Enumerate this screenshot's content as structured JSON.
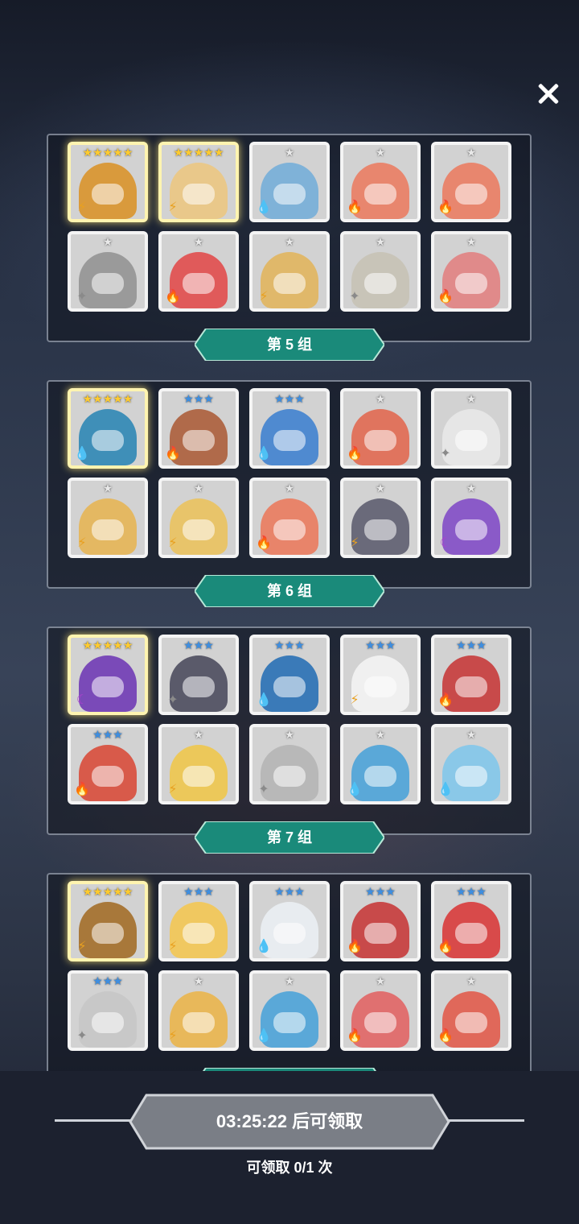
{
  "groups": [
    {
      "label": "",
      "cards": [
        {
          "name": "tiger-hero",
          "stars": "★★★★★",
          "stars_level": 5,
          "element": "earth",
          "elem_glyph": "⚡",
          "art": "#d99a3c",
          "gold": true
        },
        {
          "name": "elder-sage",
          "stars": "★★★★★",
          "stars_level": 5,
          "element": "earth",
          "elem_glyph": "⚡",
          "art": "#e9c88a",
          "gold": true
        },
        {
          "name": "mummy",
          "stars": "★",
          "stars_level": 1,
          "element": "water",
          "elem_glyph": "💧",
          "art": "#7fb2d8",
          "gold": false
        },
        {
          "name": "red-bow-girl",
          "stars": "★",
          "stars_level": 1,
          "element": "fire",
          "elem_glyph": "🔥",
          "art": "#e8866e",
          "gold": false
        },
        {
          "name": "red-bow-girl-2",
          "stars": "★",
          "stars_level": 1,
          "element": "fire",
          "elem_glyph": "🔥",
          "art": "#e8866e",
          "gold": false
        },
        {
          "name": "spiky-beast",
          "stars": "★",
          "stars_level": 1,
          "element": "light",
          "elem_glyph": "✦",
          "art": "#9a9a9a",
          "gold": false
        },
        {
          "name": "red-bird",
          "stars": "★",
          "stars_level": 1,
          "element": "fire",
          "elem_glyph": "🔥",
          "art": "#e05a5a",
          "gold": false
        },
        {
          "name": "golden-warrior",
          "stars": "★",
          "stars_level": 1,
          "element": "earth",
          "elem_glyph": "⚡",
          "art": "#e0b86a",
          "gold": false
        },
        {
          "name": "stone-helmet",
          "stars": "★",
          "stars_level": 1,
          "element": "light",
          "elem_glyph": "✦",
          "art": "#c8c4b8",
          "gold": false
        },
        {
          "name": "pink-moai",
          "stars": "★",
          "stars_level": 1,
          "element": "fire",
          "elem_glyph": "🔥",
          "art": "#e08a8a",
          "gold": false
        }
      ]
    },
    {
      "label": "第 5 组",
      "cards": [
        {
          "name": "blue-dragon",
          "stars": "★★★★★",
          "stars_level": 5,
          "element": "water",
          "elem_glyph": "💧",
          "art": "#3f8fb8",
          "gold": true
        },
        {
          "name": "antler-queen",
          "stars": "★★★",
          "stars_level": 3,
          "element": "fire",
          "elem_glyph": "🔥",
          "art": "#b06a4a",
          "gold": false
        },
        {
          "name": "crown-priestess",
          "stars": "★★★",
          "stars_level": 3,
          "element": "water",
          "elem_glyph": "💧",
          "art": "#4f8ad0",
          "gold": false
        },
        {
          "name": "cactus-red",
          "stars": "★",
          "stars_level": 1,
          "element": "fire",
          "elem_glyph": "🔥",
          "art": "#e0745e",
          "gold": false
        },
        {
          "name": "ghost",
          "stars": "★",
          "stars_level": 1,
          "element": "light",
          "elem_glyph": "✦",
          "art": "#e6e6e6",
          "gold": false
        },
        {
          "name": "lion",
          "stars": "★",
          "stars_level": 1,
          "element": "earth",
          "elem_glyph": "⚡",
          "art": "#e4b862",
          "gold": false
        },
        {
          "name": "golden-lion",
          "stars": "★",
          "stars_level": 1,
          "element": "earth",
          "elem_glyph": "⚡",
          "art": "#e8c46a",
          "gold": false
        },
        {
          "name": "red-helmet",
          "stars": "★",
          "stars_level": 1,
          "element": "fire",
          "elem_glyph": "🔥",
          "art": "#e8846a",
          "gold": false
        },
        {
          "name": "knight",
          "stars": "★",
          "stars_level": 1,
          "element": "earth",
          "elem_glyph": "⚡",
          "art": "#6a6a7a",
          "gold": false
        },
        {
          "name": "purple-mage",
          "stars": "★",
          "stars_level": 1,
          "element": "dark",
          "elem_glyph": "☾",
          "art": "#8a5ac8",
          "gold": false
        }
      ]
    },
    {
      "label": "第 6 组",
      "cards": [
        {
          "name": "hooded-purple",
          "stars": "★★★★★",
          "stars_level": 5,
          "element": "dark",
          "elem_glyph": "☾",
          "art": "#7a4ab8",
          "gold": true
        },
        {
          "name": "dark-swordsman",
          "stars": "★★★",
          "stars_level": 3,
          "element": "light",
          "elem_glyph": "✦",
          "art": "#5a5a6a",
          "gold": false
        },
        {
          "name": "blue-hood",
          "stars": "★★★",
          "stars_level": 3,
          "element": "water",
          "elem_glyph": "💧",
          "art": "#3a7ab8",
          "gold": false
        },
        {
          "name": "bunny",
          "stars": "★★★",
          "stars_level": 3,
          "element": "earth",
          "elem_glyph": "⚡",
          "art": "#f0f0f0",
          "gold": false
        },
        {
          "name": "oni-mask",
          "stars": "★★★",
          "stars_level": 3,
          "element": "fire",
          "elem_glyph": "🔥",
          "art": "#c84a4a",
          "gold": false
        },
        {
          "name": "red-hood",
          "stars": "★★★",
          "stars_level": 3,
          "element": "fire",
          "elem_glyph": "🔥",
          "art": "#d85a4a",
          "gold": false
        },
        {
          "name": "fluffy-yellow",
          "stars": "★",
          "stars_level": 1,
          "element": "earth",
          "elem_glyph": "⚡",
          "art": "#ecc85a",
          "gold": false
        },
        {
          "name": "fluffy-grey",
          "stars": "★",
          "stars_level": 1,
          "element": "light",
          "elem_glyph": "✦",
          "art": "#b8b8b8",
          "gold": false
        },
        {
          "name": "blue-bow-girl",
          "stars": "★",
          "stars_level": 1,
          "element": "water",
          "elem_glyph": "💧",
          "art": "#5aa8d8",
          "gold": false
        },
        {
          "name": "cat-girl",
          "stars": "★",
          "stars_level": 1,
          "element": "water",
          "elem_glyph": "💧",
          "art": "#8ac8e8",
          "gold": false
        }
      ]
    },
    {
      "label": "第 7 组",
      "cards": [
        {
          "name": "tribal-shield",
          "stars": "★★★★★",
          "stars_level": 5,
          "element": "earth",
          "elem_glyph": "⚡",
          "art": "#a8783a",
          "gold": true
        },
        {
          "name": "blonde-warrior",
          "stars": "★★★",
          "stars_level": 3,
          "element": "earth",
          "elem_glyph": "⚡",
          "art": "#f0c860",
          "gold": false
        },
        {
          "name": "horned-ghost",
          "stars": "★★★",
          "stars_level": 3,
          "element": "water",
          "elem_glyph": "💧",
          "art": "#e8ecf0",
          "gold": false
        },
        {
          "name": "oni-mask-2",
          "stars": "★★★",
          "stars_level": 3,
          "element": "fire",
          "elem_glyph": "🔥",
          "art": "#c84a4a",
          "gold": false
        },
        {
          "name": "red-cyclops",
          "stars": "★★★",
          "stars_level": 3,
          "element": "fire",
          "elem_glyph": "🔥",
          "art": "#d84a4a",
          "gold": false
        },
        {
          "name": "armored-knight",
          "stars": "★★★",
          "stars_level": 3,
          "element": "light",
          "elem_glyph": "✦",
          "art": "#c8c8c8",
          "gold": false
        },
        {
          "name": "cactus-yellow",
          "stars": "★",
          "stars_level": 1,
          "element": "earth",
          "elem_glyph": "⚡",
          "art": "#e8b85a",
          "gold": false
        },
        {
          "name": "blue-mage",
          "stars": "★",
          "stars_level": 1,
          "element": "water",
          "elem_glyph": "💧",
          "art": "#5aa8d8",
          "gold": false
        },
        {
          "name": "red-hood-girl",
          "stars": "★",
          "stars_level": 1,
          "element": "fire",
          "elem_glyph": "🔥",
          "art": "#e07070",
          "gold": false
        },
        {
          "name": "winged-helm",
          "stars": "★",
          "stars_level": 1,
          "element": "fire",
          "elem_glyph": "🔥",
          "art": "#e0685a",
          "gold": false
        }
      ]
    }
  ],
  "footer": {
    "claim_button": "03:25:22 后可领取",
    "claim_count": "可领取 0/1 次"
  },
  "colors": {
    "label_teal": "#1a8a7a",
    "fire": "#e04a2a",
    "water": "#2a7ad8",
    "earth": "#e8a020",
    "light": "#8a8a8a",
    "dark": "#b040d0"
  }
}
